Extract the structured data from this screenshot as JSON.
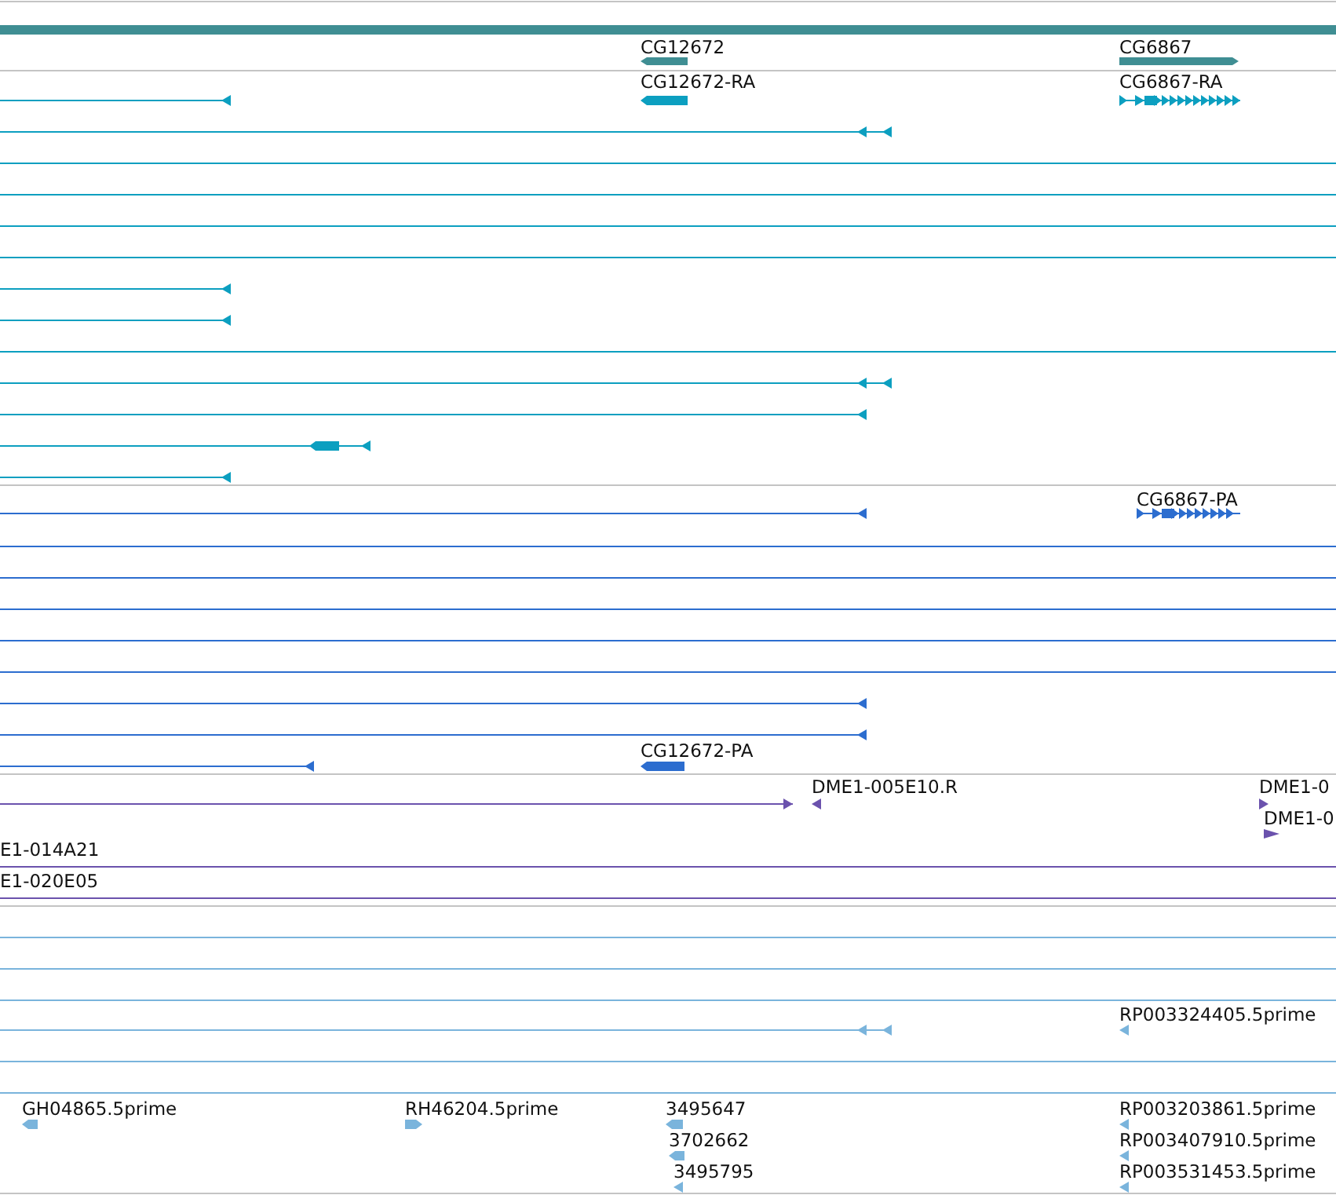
{
  "tracks": [
    {
      "kind": "gene",
      "color": "#3f8e93",
      "features": [
        {
          "label": "CG12672",
          "reverse": true
        },
        {
          "label": "CG6867",
          "reverse": false
        }
      ]
    },
    {
      "kind": "transcript",
      "color": "#0c9fc0",
      "features": [
        {
          "label": "CG12672-RA",
          "reverse": true
        },
        {
          "label": "CG6867-RA",
          "reverse": false
        }
      ]
    },
    {
      "kind": "protein",
      "color": "#2c6dcf",
      "features": [
        {
          "label": "CG6867-PA",
          "reverse": false
        },
        {
          "label": "CG12672-PA",
          "reverse": true
        }
      ]
    },
    {
      "kind": "clone",
      "color": "#6b52ad",
      "features": [
        {
          "label": "DME1-005E10.R",
          "reverse": true
        },
        {
          "label": "DME1-0",
          "reverse": false
        },
        {
          "label": "DME1-0",
          "reverse": false
        },
        {
          "label": "E1-014A21"
        },
        {
          "label": "E1-020E05"
        }
      ]
    },
    {
      "kind": "est",
      "color": "#7ab4dc",
      "features": [
        {
          "label": "RP003324405.5prime",
          "reverse": true
        },
        {
          "label": "GH04865.5prime",
          "reverse": true
        },
        {
          "label": "RH46204.5prime",
          "reverse": false
        },
        {
          "label": "3495647",
          "reverse": true
        },
        {
          "label": "RP003203861.5prime",
          "reverse": true
        },
        {
          "label": "3702662",
          "reverse": true
        },
        {
          "label": "RP003407910.5prime",
          "reverse": true
        },
        {
          "label": "3495795",
          "reverse": true
        },
        {
          "label": "RP003531453.5prime",
          "reverse": true
        }
      ]
    }
  ]
}
